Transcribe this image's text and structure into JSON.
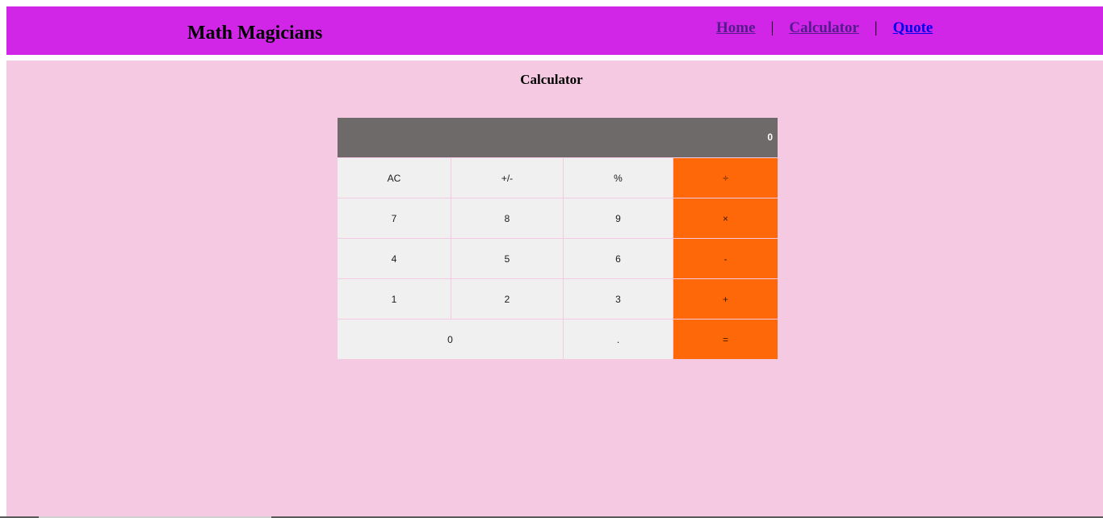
{
  "header": {
    "brand": "Math Magicians",
    "nav": [
      {
        "label": "Home"
      },
      {
        "label": "Calculator"
      },
      {
        "label": "Quote"
      }
    ],
    "separator": "|",
    "background": "#d126e8"
  },
  "main": {
    "title": "Calculator",
    "background": "#f5c9e1"
  },
  "calculator": {
    "display": "0",
    "keys": {
      "ac": "AC",
      "sign": "+/-",
      "percent": "%",
      "divide": "÷",
      "seven": "7",
      "eight": "8",
      "nine": "9",
      "multiply": "×",
      "four": "4",
      "five": "5",
      "six": "6",
      "minus": "-",
      "one": "1",
      "two": "2",
      "three": "3",
      "plus": "+",
      "zero": "0",
      "dot": ".",
      "equals": "="
    },
    "colors": {
      "display_bg": "#6e6a69",
      "key_bg": "#f0f0f0",
      "operator_bg": "#ff6808"
    }
  }
}
